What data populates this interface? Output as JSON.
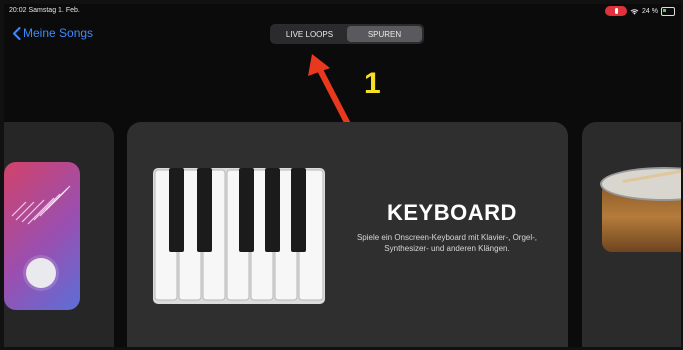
{
  "status_bar": {
    "time": "20:02  Samstag 1. Feb.",
    "battery": "24 %"
  },
  "nav": {
    "back_label": "Meine Songs"
  },
  "segmented": {
    "options": [
      "LIVE LOOPS",
      "SPUREN"
    ],
    "selected": "SPUREN"
  },
  "annotation": {
    "number": "1",
    "color": "#f5e022",
    "arrow_color": "#e8381e"
  },
  "cards": {
    "main": {
      "title": "KEYBOARD",
      "description": "Spiele ein Onscreen-Keyboard mit Klavier-, Orgel-, Synthesizer- und anderen Klängen."
    }
  },
  "colors": {
    "accent": "#3a8bff",
    "background": "#0b0b0b",
    "card": "#2f2f2f"
  }
}
